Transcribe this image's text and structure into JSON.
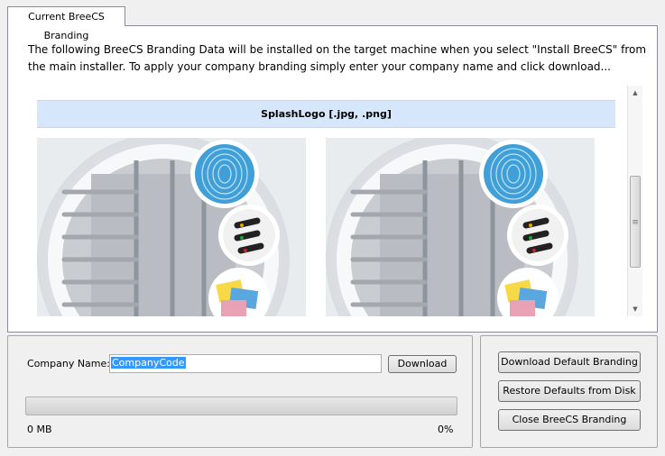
{
  "tab": {
    "label": "Current BreeCS Branding"
  },
  "description": "The following BreeCS Branding Data will be installed on the target machine when you select \"Install BreeCS\" from the main installer. To apply your company branding simply enter your company name and click download...",
  "viewer": {
    "header": "SplashLogo [.jpg, .png]"
  },
  "form": {
    "company_label": "Company Name:",
    "company_value": "CompanyCode",
    "download_button": "Download",
    "progress_size": "0 MB",
    "progress_percent": "0%",
    "progress_fraction": 0
  },
  "actions": {
    "download_default": "Download Default Branding",
    "restore_defaults": "Restore Defaults from Disk",
    "close": "Close BreeCS Branding"
  }
}
